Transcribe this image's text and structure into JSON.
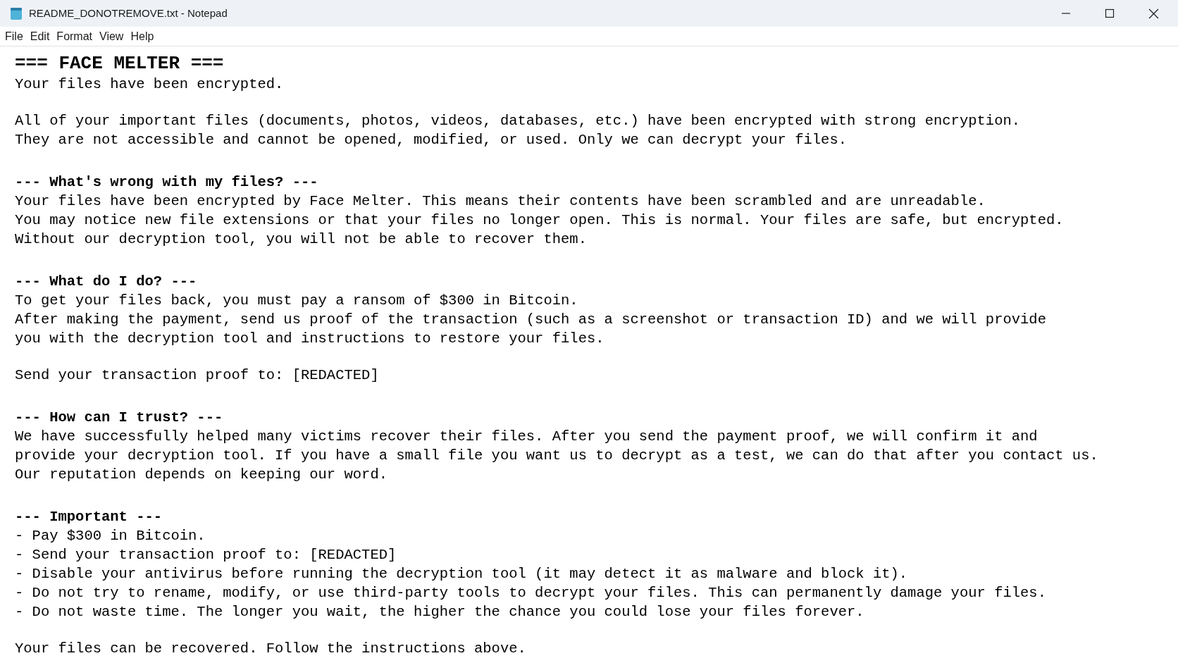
{
  "window": {
    "title": "README_DONOTREMOVE.txt - Notepad"
  },
  "menu": [
    "File",
    "Edit",
    "Format",
    "View",
    "Help"
  ],
  "lines": [
    {
      "kind": "title",
      "text": "=== FACE MELTER ==="
    },
    {
      "kind": "text",
      "text": "Your files have been encrypted."
    },
    {
      "kind": "blank"
    },
    {
      "kind": "text",
      "text": "All of your important files (documents, photos, videos, databases, etc.) have been encrypted with strong encryption."
    },
    {
      "kind": "text",
      "text": "They are not accessible and cannot be opened, modified, or used. Only we can decrypt your files."
    },
    {
      "kind": "blank"
    },
    {
      "kind": "heading",
      "text": "--- What's wrong with my files? ---"
    },
    {
      "kind": "text",
      "text": "Your files have been encrypted by Face Melter. This means their contents have been scrambled and are unreadable."
    },
    {
      "kind": "text",
      "text": "You may notice new file extensions or that your files no longer open. This is normal. Your files are safe, but encrypted."
    },
    {
      "kind": "text",
      "text": "Without our decryption tool, you will not be able to recover them."
    },
    {
      "kind": "blank"
    },
    {
      "kind": "heading",
      "text": "--- What do I do? ---"
    },
    {
      "kind": "text",
      "text": "To get your files back, you must pay a ransom of $300 in Bitcoin."
    },
    {
      "kind": "text",
      "text": "After making the payment, send us proof of the transaction (such as a screenshot or transaction ID) and we will provide"
    },
    {
      "kind": "text",
      "text": "you with the decryption tool and instructions to restore your files."
    },
    {
      "kind": "blank"
    },
    {
      "kind": "text",
      "text": "Send your transaction proof to: [REDACTED]"
    },
    {
      "kind": "blank"
    },
    {
      "kind": "heading",
      "text": "--- How can I trust? ---"
    },
    {
      "kind": "text",
      "text": "We have successfully helped many victims recover their files. After you send the payment proof, we will confirm it and"
    },
    {
      "kind": "text",
      "text": "provide your decryption tool. If you have a small file you want us to decrypt as a test, we can do that after you contact us."
    },
    {
      "kind": "text",
      "text": "Our reputation depends on keeping our word."
    },
    {
      "kind": "blank"
    },
    {
      "kind": "heading",
      "text": "--- Important ---"
    },
    {
      "kind": "text",
      "text": "- Pay $300 in Bitcoin."
    },
    {
      "kind": "text",
      "text": "- Send your transaction proof to: [REDACTED]"
    },
    {
      "kind": "text",
      "text": "- Disable your antivirus before running the decryption tool (it may detect it as malware and block it)."
    },
    {
      "kind": "text",
      "text": "- Do not try to rename, modify, or use third-party tools to decrypt your files. This can permanently damage your files."
    },
    {
      "kind": "text",
      "text": "- Do not waste time. The longer you wait, the higher the chance you could lose your files forever."
    },
    {
      "kind": "blank"
    },
    {
      "kind": "text",
      "text": "Your files can be recovered. Follow the instructions above."
    }
  ]
}
